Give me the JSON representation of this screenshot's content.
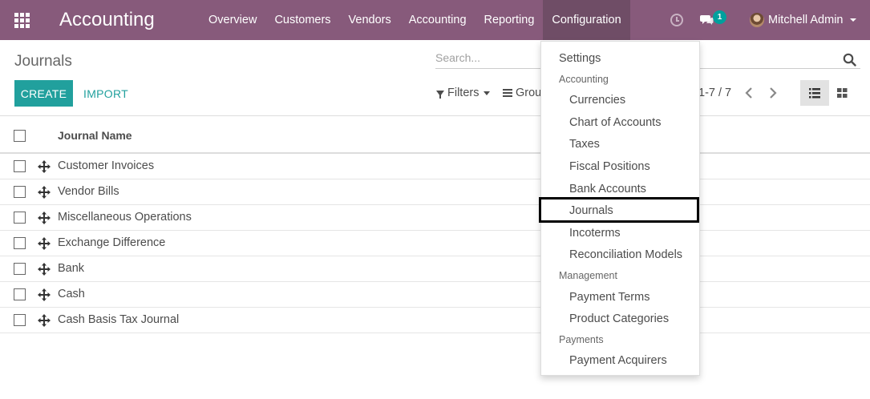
{
  "navbar": {
    "app_title": "Accounting",
    "menu": [
      "Overview",
      "Customers",
      "Vendors",
      "Accounting",
      "Reporting",
      "Configuration"
    ],
    "active_menu": "Configuration",
    "chat_badge": "1",
    "user_name": "Mitchell Admin"
  },
  "control_panel": {
    "breadcrumb": "Journals",
    "create_label": "CREATE",
    "import_label": "IMPORT",
    "search_placeholder": "Search...",
    "filters_label": "Filters",
    "groupby_label": "Grou",
    "pager": "1-7 / 7"
  },
  "table": {
    "header": "Journal Name",
    "rows": [
      "Customer Invoices",
      "Vendor Bills",
      "Miscellaneous Operations",
      "Exchange Difference",
      "Bank",
      "Cash",
      "Cash Basis Tax Journal"
    ]
  },
  "config_menu": {
    "settings": "Settings",
    "section_accounting": "Accounting",
    "accounting_items": [
      "Currencies",
      "Chart of Accounts",
      "Taxes",
      "Fiscal Positions",
      "Bank Accounts",
      "Journals",
      "Incoterms",
      "Reconciliation Models"
    ],
    "section_management": "Management",
    "management_items": [
      "Payment Terms",
      "Product Categories"
    ],
    "section_payments": "Payments",
    "payments_items": [
      "Payment Acquirers"
    ],
    "highlighted_item": "Journals"
  },
  "colors": {
    "navbar": "#875a7b",
    "navbar_active": "#6f4d66",
    "primary": "#21a09d",
    "badge": "#00a09d"
  },
  "icons": [
    "apps-grid-icon",
    "clock-icon",
    "chat-icon",
    "search-icon",
    "filter-icon",
    "groupby-icon",
    "chevron-left-icon",
    "chevron-right-icon",
    "list-view-icon",
    "kanban-view-icon",
    "drag-handle-icon"
  ]
}
